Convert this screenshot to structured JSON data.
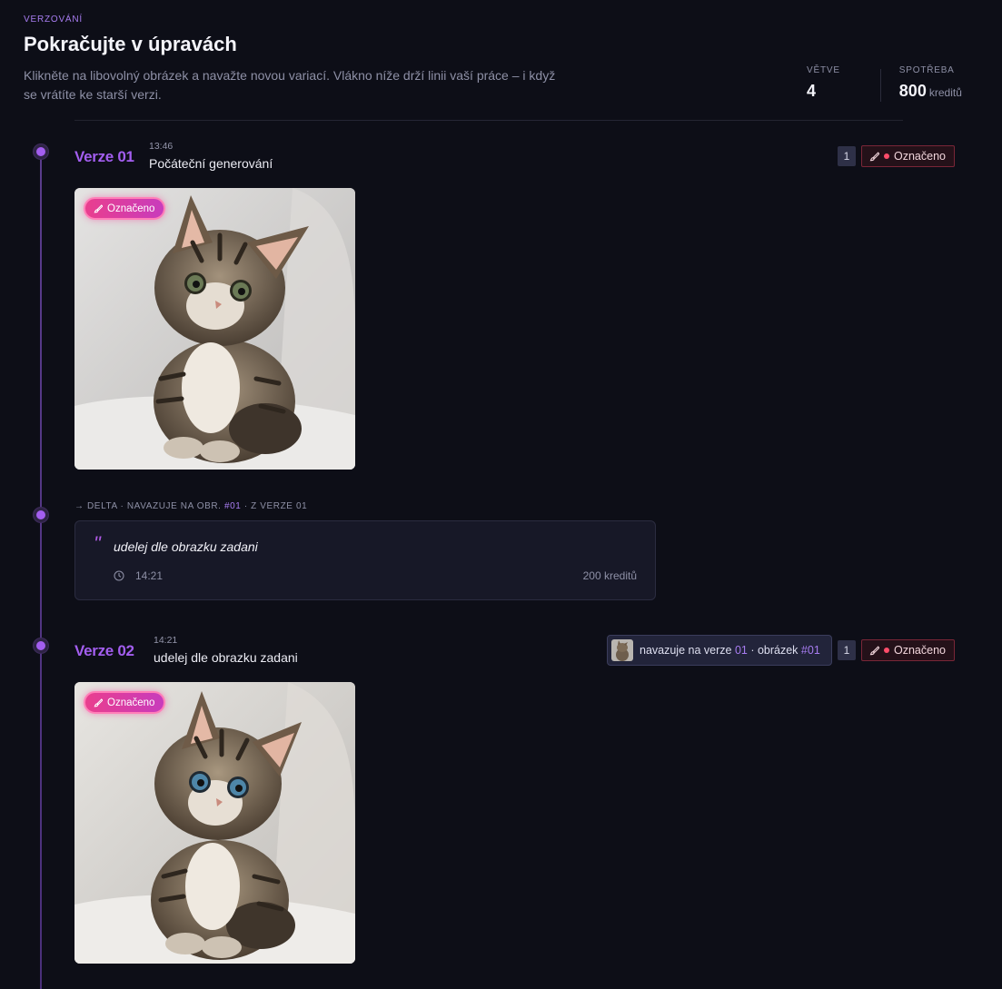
{
  "header": {
    "eyebrow": "VERZOVÁNÍ",
    "title": "Pokračujte v úpravách",
    "subtitle": "Klikněte na libovolný obrázek a navažte novou variací. Vlákno níže drží linii vaší práce – i když se vrátíte ke starší verzi.",
    "stats": [
      {
        "label": "VĚTVE",
        "value": "4",
        "unit": ""
      },
      {
        "label": "SPOTŘEBA",
        "value": "800",
        "unit": "kreditů"
      }
    ]
  },
  "versions": [
    {
      "label": "Verze 01",
      "time": "13:46",
      "description": "Počáteční generování",
      "count": "1",
      "tag": "Označeno",
      "image_pill": "Označeno"
    },
    {
      "label": "Verze 02",
      "time": "14:21",
      "description": "udelej dle obrazku zadani",
      "count": "1",
      "tag": "Označeno",
      "image_pill": "Označeno",
      "link": {
        "prefix": "navazuje na verze",
        "version": "01",
        "middle": "· obrázek",
        "image": "#01"
      }
    }
  ],
  "delta": {
    "head_prefix": "→ DELTA · NAVAZUJE NA OBR.",
    "head_image": "#01",
    "head_suffix": "· Z VERZE 01",
    "prompt": "udelej dle obrazku zadani",
    "time": "14:21",
    "credits": "200 kreditů"
  },
  "colors": {
    "accent": "#a35ef0",
    "marked_red": "#ff4d6a",
    "background": "#0d0e17"
  },
  "icons": [
    "brush-icon",
    "clock-icon",
    "quote-icon"
  ]
}
